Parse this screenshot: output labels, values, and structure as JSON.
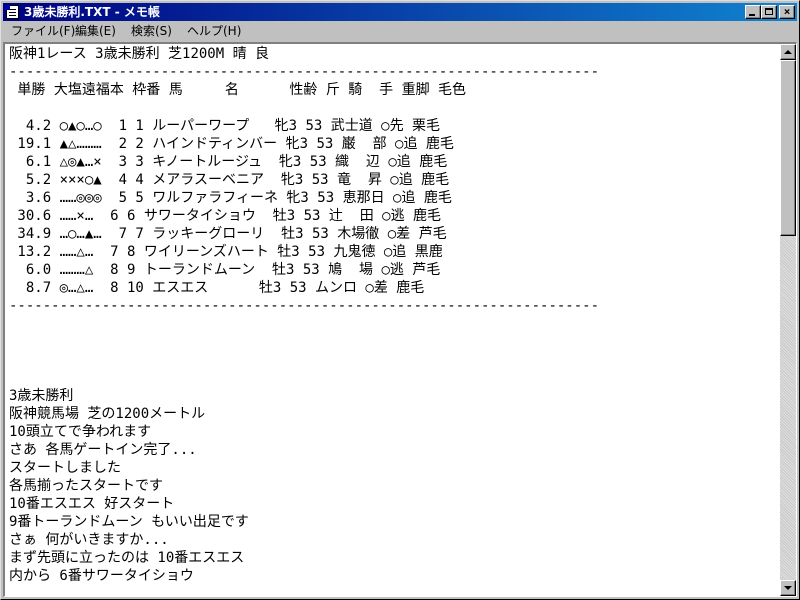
{
  "window": {
    "title": "3歳未勝利.TXT - メモ帳",
    "minimize_label": "",
    "maximize_label": "",
    "close_label": "×"
  },
  "menu": {
    "file": "ファイル(F)",
    "edit": "編集(E)",
    "search": "検索(S)",
    "help": "ヘルプ(H)"
  },
  "document": {
    "lines": [
      "阪神1レース 3歳未勝利 芝1200M 晴 良",
      "----------------------------------------------------------------------",
      " 単勝 大塩遠福本 枠番 馬     名      性齢 斤 騎  手 重脚 毛色",
      "",
      "  4.2 ○▲○…○  1 1 ルーパーワープ   牝3 53 武士道 ○先 栗毛",
      " 19.1 ▲△………  2 2 ハインドティンバー 牝3 53 巌  部 ○追 鹿毛",
      "  6.1 △◎▲…×  3 3 キノートルージュ  牝3 53 織  辺 ○追 鹿毛",
      "  5.2 ×××○▲  4 4 メアラスーベニア  牝3 53 竜  昇 ○追 鹿毛",
      "  3.6 ……◎◎◎  5 5 ワルファラフィーネ 牝3 53 恵那日 ○追 鹿毛",
      " 30.6 ……×…  6 6 サワータイショウ  牡3 53 辻  田 ○逃 鹿毛",
      " 34.9 …○…▲…  7 7 ラッキーグローリ  牡3 53 木場徹 ○差 芦毛",
      " 13.2 ……△…  7 8 ワイリーンズハート 牡3 53 九鬼徳 ○追 黒鹿",
      "  6.0 ………△  8 9 トーランドムーン  牡3 53 鳩  場 ○逃 芦毛",
      "  8.7 ◎…△…  8 10 エスエス      牡3 53 ムンロ ○差 鹿毛",
      "----------------------------------------------------------------------",
      "",
      "",
      "",
      "",
      "",
      "3歳未勝利",
      "阪神競馬場 芝の1200メートル",
      "10頭立てで争われます",
      "さあ 各馬ゲートイン完了...",
      "スタートしました",
      "各馬揃ったスタートです",
      "10番エスエス 好スタート",
      "9番トーランドムーン もいい出足です",
      "さぁ 何がいきますか...",
      "まず先頭に立ったのは 10番エスエス",
      "内から 6番サワータイショウ"
    ]
  }
}
